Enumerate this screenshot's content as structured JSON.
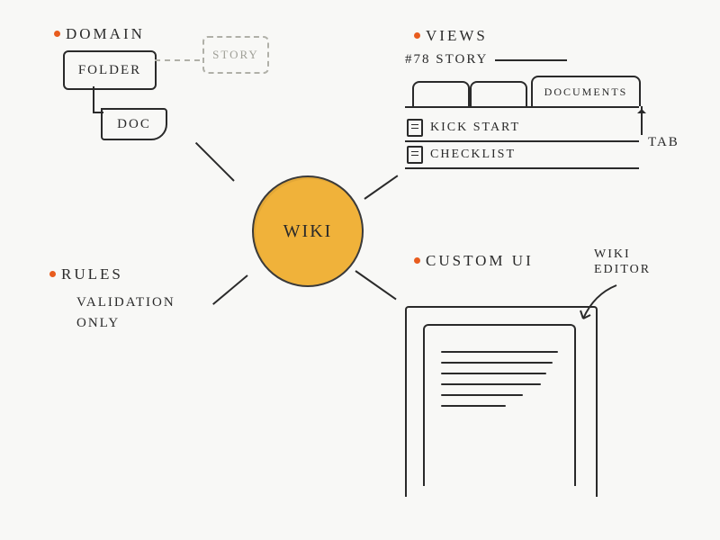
{
  "center": {
    "label": "WIKI"
  },
  "domain": {
    "heading": "DOMAIN",
    "folder": "FOLDER",
    "doc": "DOC",
    "story": "STORY"
  },
  "rules": {
    "heading": "RULES",
    "line1": "VALIDATION",
    "line2": "ONLY"
  },
  "views": {
    "heading": "VIEWS",
    "story_ref": "#78 STORY",
    "tab_active": "DOCUMENTS",
    "tab_callout": "TAB",
    "items": [
      {
        "label": "KICK START"
      },
      {
        "label": "CHECKLIST"
      }
    ]
  },
  "custom": {
    "heading": "CUSTOM  UI",
    "annotation_l1": "WIKI",
    "annotation_l2": "EDITOR"
  }
}
